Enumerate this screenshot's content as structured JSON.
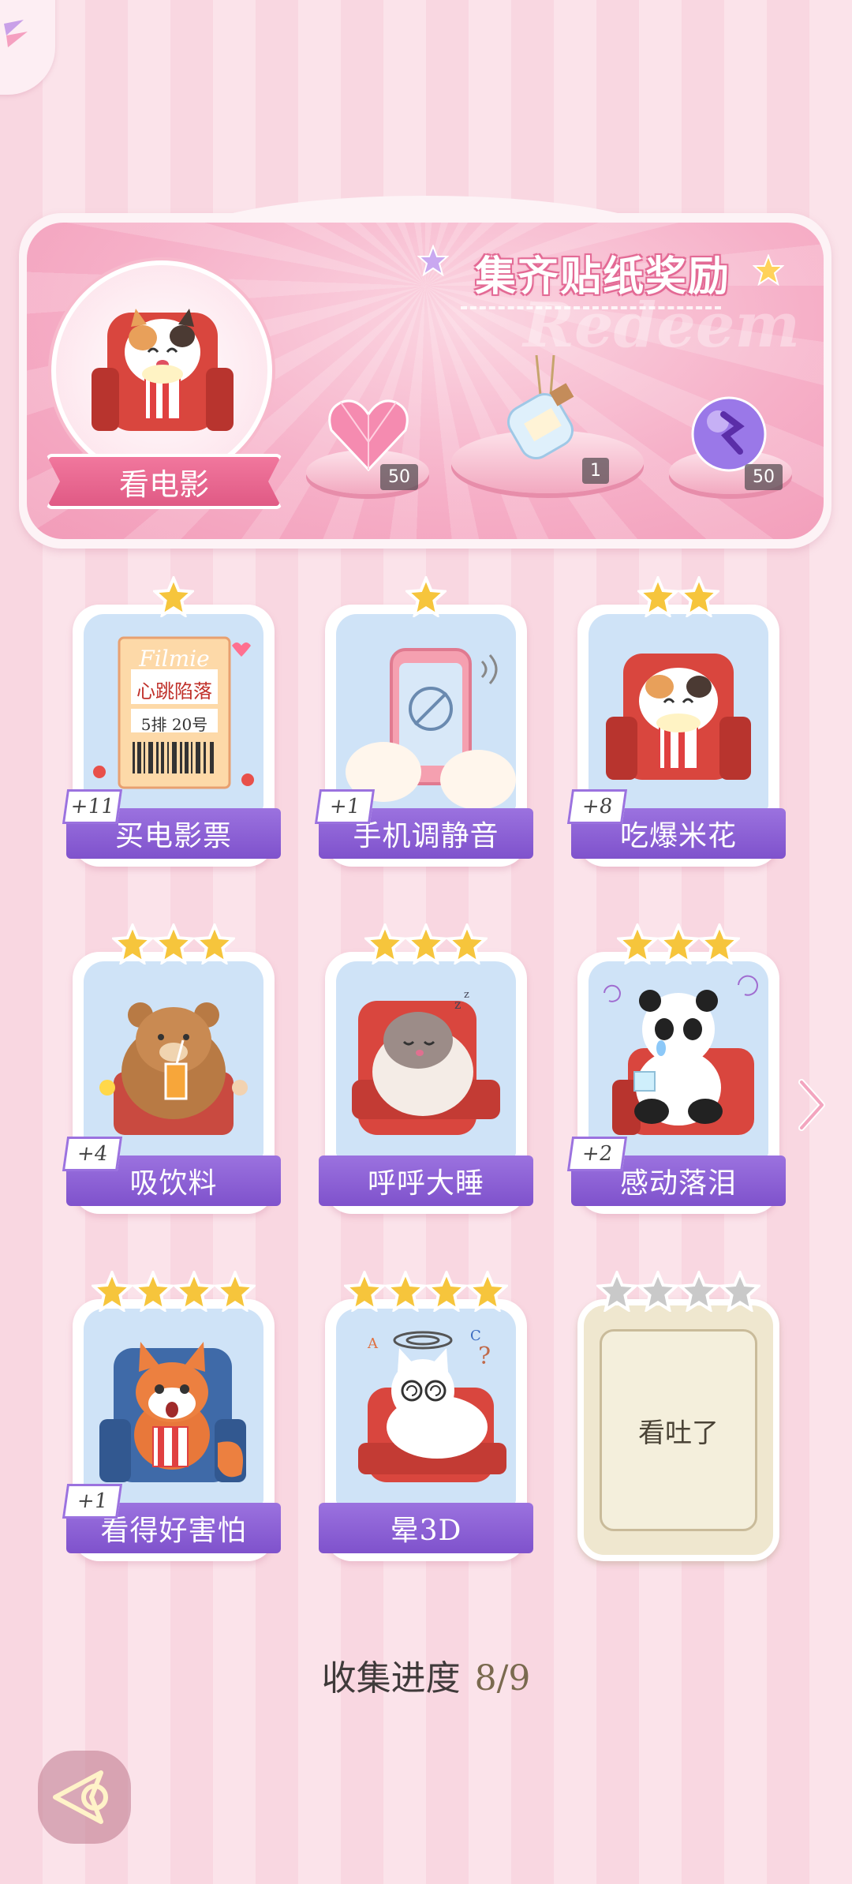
{
  "banner": {
    "title": "集齐贴纸奖励",
    "watermark": "Redeem",
    "movie_label": "看电影",
    "rewards": [
      {
        "icon": "pink-heart-gem-icon",
        "count": "50"
      },
      {
        "icon": "message-bottle-icon",
        "count": "1"
      },
      {
        "icon": "purple-energy-orb-icon",
        "count": "50"
      }
    ]
  },
  "cards": [
    {
      "label": "买电影票",
      "stars": 1,
      "plus": "+11",
      "icon": "movie-ticket-icon",
      "ticket": {
        "brand": "Filmie",
        "title": "心跳陷落",
        "seat": "5排 20号"
      }
    },
    {
      "label": "手机调静音",
      "stars": 1,
      "plus": "+1",
      "icon": "muted-phone-icon"
    },
    {
      "label": "吃爆米花",
      "stars": 2,
      "plus": "+8",
      "icon": "cat-popcorn-icon"
    },
    {
      "label": "吸饮料",
      "stars": 3,
      "plus": "+4",
      "icon": "bear-drink-icon"
    },
    {
      "label": "呼呼大睡",
      "stars": 3,
      "plus": "",
      "icon": "sleeping-hamster-icon"
    },
    {
      "label": "感动落泪",
      "stars": 3,
      "plus": "+2",
      "icon": "crying-panda-icon"
    },
    {
      "label": "看得好害怕",
      "stars": 4,
      "plus": "+1",
      "icon": "scared-fox-icon"
    },
    {
      "label": "晕3D",
      "stars": 4,
      "plus": "",
      "icon": "dizzy-cat-icon"
    },
    {
      "label": "看吐了",
      "stars": 4,
      "plus": "",
      "icon": "locked-card",
      "locked": true
    }
  ],
  "progress": {
    "label": "收集进度",
    "value": "8/9"
  },
  "colors": {
    "accent_purple": "#8a5ed4",
    "pink": "#f29bb8",
    "gold": "#f6c53c"
  }
}
